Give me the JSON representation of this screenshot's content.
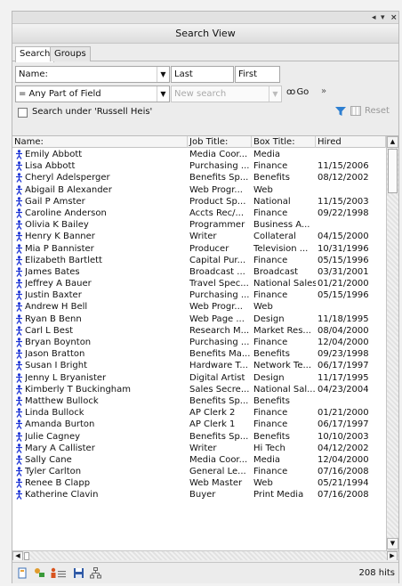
{
  "window": {
    "controls": [
      "◂",
      "▾",
      "×"
    ]
  },
  "header": {
    "title": "Search View"
  },
  "tabs": [
    {
      "label": "Search"
    },
    {
      "label": "Groups"
    }
  ],
  "search": {
    "field_select": "Name:",
    "last_label": "Last",
    "first_label": "First",
    "match_select": "= Any Part of Field",
    "new_search_placeholder": "New search",
    "go_label": "Go",
    "under_label": "Search under 'Russell Heis'",
    "reset_label": "Reset"
  },
  "table": {
    "columns": [
      "Name:",
      "Job Title:",
      "Box Title:",
      "Hired"
    ],
    "rows": [
      [
        "Emily  Abbott",
        "Media Coor...",
        "Media",
        ""
      ],
      [
        "Lisa  Abbott",
        "Purchasing ...",
        "Finance",
        "11/15/2006"
      ],
      [
        "Cheryl  Adelsperger",
        "Benefits Sp...",
        "Benefits",
        "08/12/2002"
      ],
      [
        "Abigail B Alexander",
        "Web Progr...",
        "Web",
        ""
      ],
      [
        "Gail P Amster",
        "Product Sp...",
        "National",
        "11/15/2003"
      ],
      [
        "Caroline  Anderson",
        "Accts Rec/...",
        "Finance",
        "09/22/1998"
      ],
      [
        "Olivia K Bailey",
        "Programmer",
        "Business A...",
        ""
      ],
      [
        "Henry K Banner",
        "Writer",
        "Collateral",
        "04/15/2000"
      ],
      [
        "Mia P Bannister",
        "Producer",
        "Television ...",
        "10/31/1996"
      ],
      [
        "Elizabeth  Bartlett",
        "Capital Pur...",
        "Finance",
        "05/15/1996"
      ],
      [
        "James  Bates",
        "Broadcast ...",
        "Broadcast",
        "03/31/2001"
      ],
      [
        "Jeffrey A Bauer",
        "Travel Spec...",
        "National Sales",
        "01/21/2000"
      ],
      [
        "Justin  Baxter",
        "Purchasing ...",
        "Finance",
        "05/15/1996"
      ],
      [
        "Andrew H Bell",
        "Web Progr...",
        "Web",
        ""
      ],
      [
        "Ryan B Benn",
        "Web Page ...",
        "Design",
        "11/18/1995"
      ],
      [
        "Carl L Best",
        "Research M...",
        "Market Res...",
        "08/04/2000"
      ],
      [
        "Bryan  Boynton",
        "Purchasing ...",
        "Finance",
        "12/04/2000"
      ],
      [
        "Jason  Bratton",
        "Benefits Ma...",
        "Benefits",
        "09/23/1998"
      ],
      [
        "Susan I Bright",
        "Hardware T...",
        "Network Te...",
        "06/17/1997"
      ],
      [
        "Jenny L Bryanister",
        "Digital Artist",
        "Design",
        "11/17/1995"
      ],
      [
        "Kimberly T Buckingham",
        "Sales Secre...",
        "National Sal...",
        "04/23/2004"
      ],
      [
        "Matthew  Bullock",
        "Benefits Sp...",
        "Benefits",
        ""
      ],
      [
        "Linda  Bullock",
        "AP Clerk 2",
        "Finance",
        "01/21/2000"
      ],
      [
        "Amanda  Burton",
        "AP Clerk 1",
        "Finance",
        "06/17/1997"
      ],
      [
        "Julie  Cagney",
        "Benefits Sp...",
        "Benefits",
        "10/10/2003"
      ],
      [
        "Mary A Callister",
        "Writer",
        "Hi Tech",
        "04/12/2002"
      ],
      [
        "Sally  Cane",
        "Media Coor...",
        "Media",
        "12/04/2000"
      ],
      [
        "Tyler  Carlton",
        "General Le...",
        "Finance",
        "07/16/2008"
      ],
      [
        "Renee B Clapp",
        "Web Master",
        "Web",
        "05/21/1994"
      ],
      [
        "Katherine  Clavin",
        "Buyer",
        "Print Media",
        "07/16/2008"
      ]
    ]
  },
  "status": {
    "hits": "208 hits"
  },
  "colors": {
    "person_icon": "#1f36d6",
    "accent": "#2b5fc7"
  }
}
